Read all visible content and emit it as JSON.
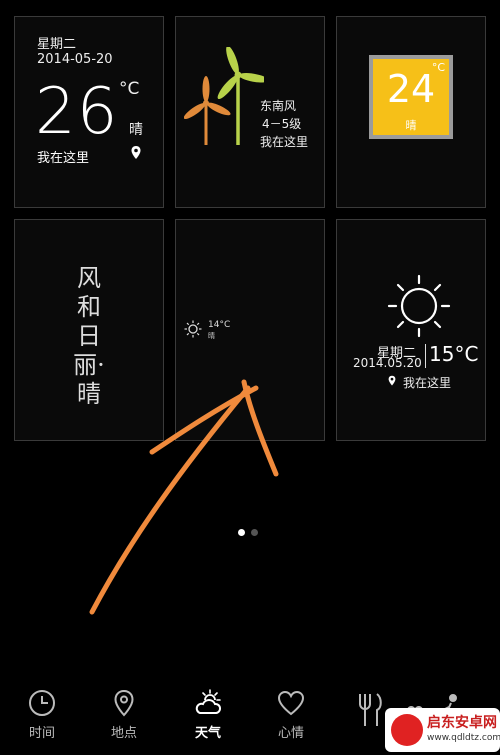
{
  "widget1": {
    "day": "星期二",
    "date": "2014-05-20",
    "temp": "26",
    "unit": "°C",
    "condition": "晴",
    "location": "我在这里"
  },
  "widget2": {
    "wind_direction": "东南风",
    "wind_level": "4－5级",
    "location": "我在这里"
  },
  "widget3": {
    "temp": "24",
    "unit": "°C",
    "condition": "晴"
  },
  "widget4": {
    "phrase_lines": [
      "风",
      "和",
      "日",
      "丽·",
      "晴"
    ]
  },
  "widget5": {
    "temp": "14°C",
    "condition": "晴"
  },
  "widget6": {
    "day": "星期二",
    "date": "2014.05.20",
    "temp": "15°C",
    "location": "我在这里"
  },
  "pager": {
    "total": 2,
    "active": 1
  },
  "nav": {
    "items": [
      {
        "label": "时间",
        "icon": "clock-icon"
      },
      {
        "label": "地点",
        "icon": "location-pin-icon"
      },
      {
        "label": "天气",
        "icon": "weather-cloud-icon",
        "active": true
      },
      {
        "label": "心情",
        "icon": "heart-icon"
      }
    ]
  },
  "watermark": {
    "name": "启东安卓网",
    "url": "www.qdldtz.com"
  },
  "colors": {
    "accent_yellow": "#f6c018",
    "windmill_orange": "#e08a3a",
    "windmill_green": "#b8d24a",
    "arrow_orange": "#f08a3c"
  }
}
